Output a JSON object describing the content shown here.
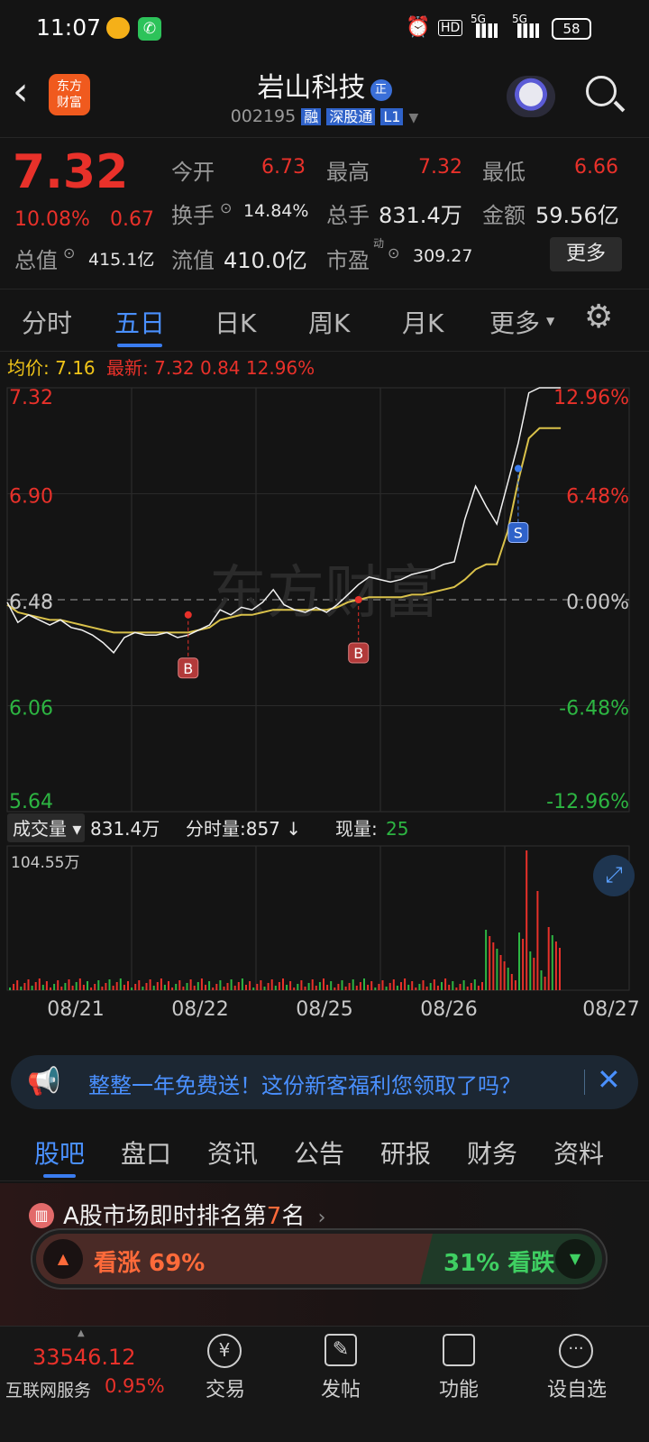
{
  "status_bar": {
    "time": "11:07",
    "network_1": "5G",
    "network_2": "5G",
    "hd": "HD",
    "battery": "58"
  },
  "header": {
    "brand_logo": "东方\n财富",
    "stock_name": "岩山科技",
    "name_badge": "正",
    "code": "002195",
    "tags": [
      "融",
      "深股通",
      "L1"
    ]
  },
  "quote": {
    "price": "7.32",
    "change_pct": "10.08%",
    "change_amt": "0.67",
    "open_label": "今开",
    "open": "6.73",
    "high_label": "最高",
    "high": "7.32",
    "low_label": "最低",
    "low": "6.66",
    "turnover_label": "换手",
    "turnover": "14.84%",
    "volume_label": "总手",
    "volume": "831.4万",
    "amount_label": "金额",
    "amount": "59.56亿",
    "mktcap_label": "总值",
    "mktcap": "415.1亿",
    "float_label": "流值",
    "float_cap": "410.0亿",
    "pe_label": "市盈",
    "pe_super": "动",
    "pe": "309.27",
    "more_button": "更多"
  },
  "tabs": [
    "分时",
    "五日",
    "日K",
    "周K",
    "月K",
    "更多"
  ],
  "active_tab": 1,
  "chart_info": {
    "avg_label": "均价:",
    "avg": "7.16",
    "latest_label": "最新:",
    "latest": "7.32",
    "latest_chg": "0.84",
    "latest_pct": "12.96%"
  },
  "chart_data": {
    "type": "line",
    "x": [
      "08/21",
      "08/22",
      "08/25",
      "08/26",
      "08/27"
    ],
    "ylim": [
      5.64,
      7.32
    ],
    "y_ticks_left": [
      "7.32",
      "6.90",
      "6.48",
      "6.06",
      "5.64"
    ],
    "y_ticks_right": [
      "12.96%",
      "6.48%",
      "0.00%",
      "-6.48%",
      "-12.96%"
    ],
    "reference": 6.48,
    "price_series": [
      6.47,
      6.39,
      6.42,
      6.4,
      6.38,
      6.4,
      6.37,
      6.36,
      6.34,
      6.31,
      6.27,
      6.33,
      6.35,
      6.34,
      6.34,
      6.35,
      6.33,
      6.34,
      6.36,
      6.38,
      6.44,
      6.42,
      6.45,
      6.44,
      6.47,
      6.52,
      6.46,
      6.44,
      6.43,
      6.45,
      6.43,
      6.46,
      6.5,
      6.54,
      6.57,
      6.56,
      6.55,
      6.56,
      6.58,
      6.59,
      6.6,
      6.62,
      6.63,
      6.8,
      6.93,
      6.85,
      6.78,
      6.94,
      7.1,
      7.3,
      7.32,
      7.32,
      7.32
    ],
    "avg_series": [
      6.46,
      6.43,
      6.42,
      6.41,
      6.4,
      6.4,
      6.39,
      6.38,
      6.37,
      6.36,
      6.35,
      6.35,
      6.35,
      6.35,
      6.35,
      6.35,
      6.35,
      6.35,
      6.36,
      6.37,
      6.4,
      6.41,
      6.42,
      6.42,
      6.43,
      6.44,
      6.44,
      6.44,
      6.44,
      6.44,
      6.44,
      6.45,
      6.47,
      6.48,
      6.49,
      6.49,
      6.49,
      6.49,
      6.5,
      6.5,
      6.51,
      6.52,
      6.53,
      6.56,
      6.6,
      6.62,
      6.62,
      6.75,
      6.95,
      7.12,
      7.16,
      7.16,
      7.16
    ],
    "markers": [
      {
        "label": "B",
        "type": "buy"
      },
      {
        "label": "B",
        "type": "buy"
      },
      {
        "label": "S",
        "type": "sell"
      }
    ],
    "watermark": "东方财富",
    "volume": {
      "label": "成交量",
      "total": "831.4万",
      "tick_label": "分时量:",
      "tick": "857",
      "current_label": "现量:",
      "current": "25",
      "max_label": "104.55万"
    }
  },
  "banner": {
    "text": "整整一年免费送！这份新客福利您领取了吗？"
  },
  "subtabs": [
    "股吧",
    "盘口",
    "资讯",
    "公告",
    "研报",
    "财务",
    "资料"
  ],
  "rank": {
    "prefix": "A股市场即时排名第",
    "rank": "7",
    "suffix": "名",
    "bull": "看涨 69%",
    "bear": "31% 看跌"
  },
  "bottom": {
    "index_value": "33546.12",
    "index_name": "互联网服务",
    "index_pct": "0.95%",
    "items": [
      "交易",
      "发帖",
      "功能",
      "设自选"
    ]
  }
}
